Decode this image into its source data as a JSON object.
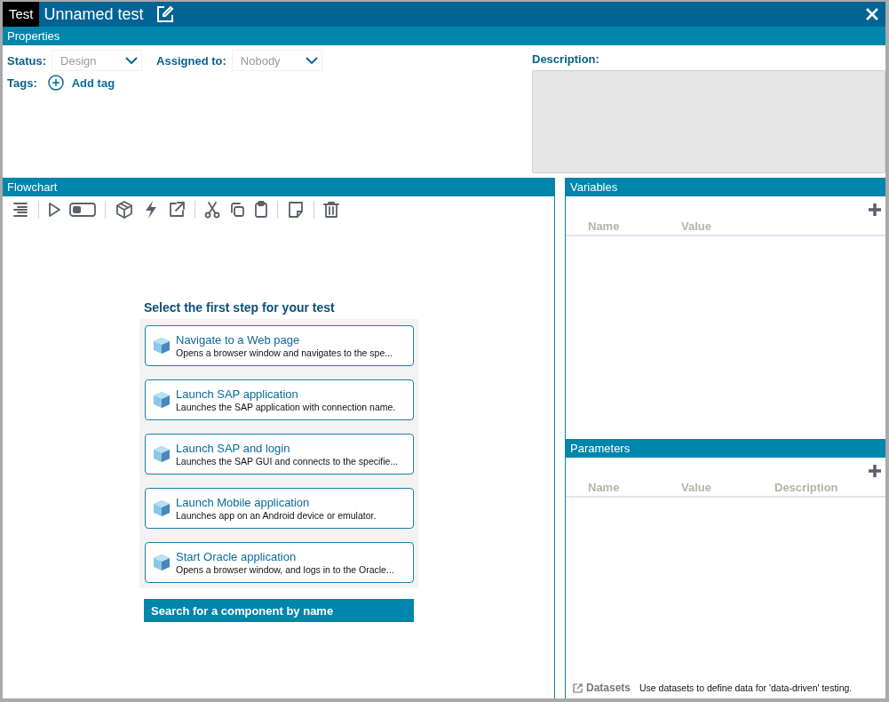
{
  "window": {
    "tab": "Test",
    "title": "Unnamed test"
  },
  "properties": {
    "header": "Properties",
    "status": {
      "label": "Status:",
      "value": "Design"
    },
    "assigned": {
      "label": "Assigned to:",
      "value": "Nobody"
    },
    "tags": {
      "label": "Tags:",
      "action": "Add tag"
    },
    "description": {
      "label": "Description:"
    }
  },
  "flowchart": {
    "header": "Flowchart",
    "prompt": "Select the first step for your test",
    "steps": [
      {
        "title": "Navigate to a Web page",
        "description": "Opens a browser window and navigates to the spe..."
      },
      {
        "title": "Launch SAP application",
        "description": "Launches the SAP application with connection name."
      },
      {
        "title": "Launch SAP and login",
        "description": "Launches the SAP GUI and connects to the specifie..."
      },
      {
        "title": "Launch Mobile application",
        "description": "Launches app on an Android device or emulator."
      },
      {
        "title": "Start Oracle application",
        "description": "Opens a browser window, and logs in to the Oracle..."
      }
    ],
    "search_button": "Search for a component by name"
  },
  "variables": {
    "header": "Variables",
    "columns": [
      "Name",
      "Value"
    ]
  },
  "parameters": {
    "header": "Parameters",
    "columns": [
      "Name",
      "Value",
      "Description"
    ]
  },
  "datasets": {
    "link": "Datasets",
    "hint": "Use datasets to define data for 'data-driven' testing."
  }
}
